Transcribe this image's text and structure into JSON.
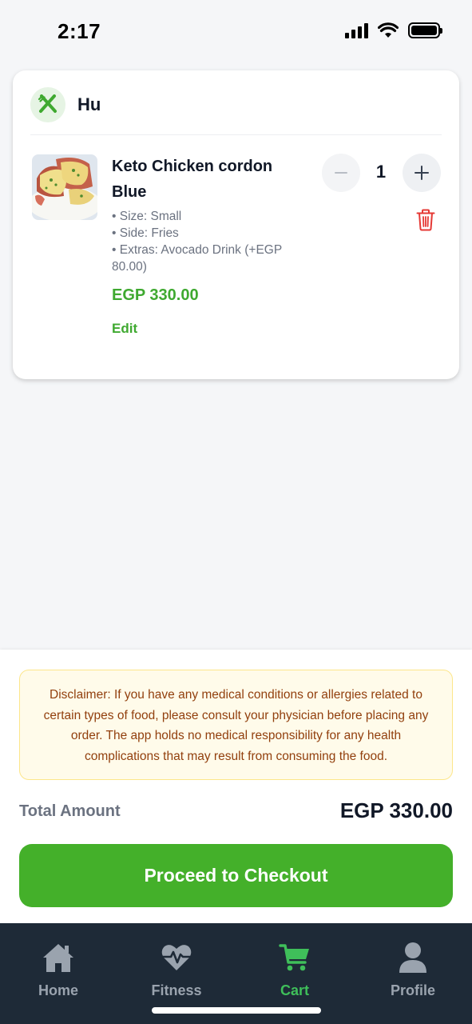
{
  "status_bar": {
    "time": "2:17"
  },
  "restaurant": {
    "name": "Hu",
    "icon": "utensils-icon"
  },
  "cart_item": {
    "title": "Keto Chicken cordon Blue",
    "details": [
      "• Size: Small",
      "• Side: Fries",
      "• Extras: Avocado Drink (+EGP 80.00)"
    ],
    "price": "EGP 330.00",
    "edit_label": "Edit",
    "quantity": "1"
  },
  "disclaimer": "Disclaimer: If you have any medical conditions or allergies related to certain types of food, please consult your physician before placing any order. The app holds no medical responsibility for any health complications that may result from consuming the food.",
  "total": {
    "label": "Total Amount",
    "value": "EGP 330.00"
  },
  "checkout_label": "Proceed to Checkout",
  "nav": {
    "items": [
      {
        "label": "Home",
        "icon": "home-icon"
      },
      {
        "label": "Fitness",
        "icon": "heart-pulse-icon"
      },
      {
        "label": "Cart",
        "icon": "cart-icon"
      },
      {
        "label": "Profile",
        "icon": "user-icon"
      }
    ],
    "active": "Cart"
  },
  "colors": {
    "accent": "#44b02a",
    "nav_background": "#1e2a37",
    "nav_active": "#3fbf5a",
    "delete": "#e53935"
  }
}
